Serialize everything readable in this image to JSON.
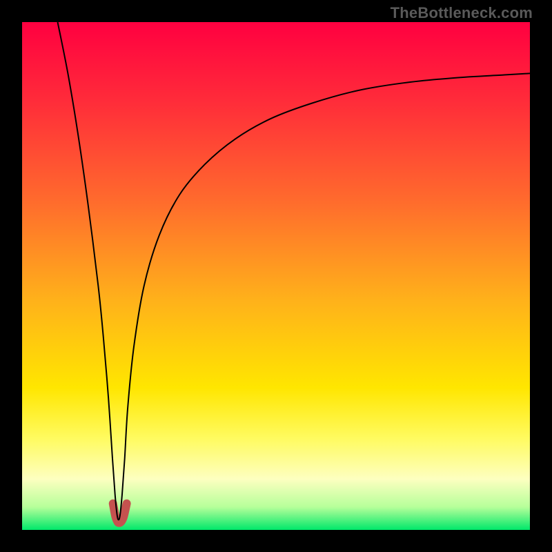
{
  "attribution": "TheBottleneck.com",
  "chart_data": {
    "type": "line",
    "title": "",
    "xlabel": "",
    "ylabel": "",
    "xlim": [
      0,
      100
    ],
    "ylim": [
      0,
      100
    ],
    "grid": false,
    "legend": false,
    "annotations": [],
    "background_gradient_stops": [
      {
        "offset": 0.0,
        "color": "#ff0040"
      },
      {
        "offset": 0.15,
        "color": "#ff2a3a"
      },
      {
        "offset": 0.35,
        "color": "#ff6a2d"
      },
      {
        "offset": 0.55,
        "color": "#ffb21a"
      },
      {
        "offset": 0.72,
        "color": "#ffe600"
      },
      {
        "offset": 0.82,
        "color": "#fffb60"
      },
      {
        "offset": 0.9,
        "color": "#fdffc0"
      },
      {
        "offset": 0.955,
        "color": "#b6ff9a"
      },
      {
        "offset": 1.0,
        "color": "#00e86a"
      }
    ],
    "series": [
      {
        "name": "bottleneck-curve",
        "color": "#000000",
        "width": 2.0,
        "x": [
          7.0,
          9.0,
          11.0,
          13.0,
          15.0,
          16.0,
          17.0,
          17.8,
          18.3,
          18.7,
          19.0,
          19.3,
          19.7,
          20.2,
          20.8,
          22.0,
          24.0,
          27.0,
          31.0,
          36.0,
          42.0,
          49.0,
          57.0,
          66.0,
          75.0,
          85.0,
          95.0,
          100.0
        ],
        "y": [
          100.0,
          90.0,
          78.0,
          64.0,
          48.0,
          38.0,
          26.0,
          14.0,
          7.0,
          3.0,
          2.0,
          3.0,
          7.0,
          14.0,
          24.0,
          36.0,
          48.0,
          58.0,
          66.0,
          72.0,
          77.0,
          81.0,
          84.0,
          86.5,
          88.0,
          89.0,
          89.6,
          89.9
        ]
      },
      {
        "name": "valley-marker",
        "color": "#c5524f",
        "width": 12.0,
        "linecap": "round",
        "x": [
          17.9,
          18.4,
          18.8,
          19.1,
          19.5,
          20.0,
          20.6
        ],
        "y": [
          5.2,
          2.6,
          1.6,
          1.4,
          1.6,
          2.6,
          5.2
        ]
      }
    ]
  }
}
